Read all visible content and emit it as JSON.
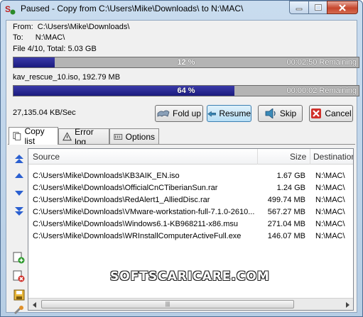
{
  "window": {
    "title": "Paused - Copy from C:\\Users\\Mike\\Downloads\\ to N:\\MAC\\"
  },
  "info": {
    "from_label": "From:",
    "from_value": "C:\\Users\\Mike\\Downloads\\",
    "to_label": "To:",
    "to_value": "N:\\MAC\\",
    "file_summary": "File 4/10, Total: 5.03 GB",
    "current_file": "kav_rescue_10.iso, 192.79 MB",
    "speed": "27,135.04 KB/Sec"
  },
  "progress": {
    "total": {
      "percent": 12,
      "label": "12 %",
      "remaining": "00:02:50 Remaining"
    },
    "file": {
      "percent": 64,
      "label": "64 %",
      "remaining": "00:00:02 Remaining"
    }
  },
  "buttons": {
    "fold_up": "Fold up",
    "resume": "Resume",
    "skip": "Skip",
    "cancel": "Cancel"
  },
  "tabs": {
    "copy_list": "Copy list",
    "error_log": "Error log",
    "options": "Options"
  },
  "list": {
    "columns": {
      "source": "Source",
      "size": "Size",
      "destination": "Destination"
    },
    "rows": [
      {
        "source": "C:\\Users\\Mike\\Downloads\\KB3AIK_EN.iso",
        "size": "1.67 GB",
        "destination": "N:\\MAC\\"
      },
      {
        "source": "C:\\Users\\Mike\\Downloads\\OfficialCnCTiberianSun.rar",
        "size": "1.24 GB",
        "destination": "N:\\MAC\\"
      },
      {
        "source": "C:\\Users\\Mike\\Downloads\\RedAlert1_AlliedDisc.rar",
        "size": "499.74 MB",
        "destination": "N:\\MAC\\"
      },
      {
        "source": "C:\\Users\\Mike\\Downloads\\VMware-workstation-full-7.1.0-2610...",
        "size": "567.27 MB",
        "destination": "N:\\MAC\\"
      },
      {
        "source": "C:\\Users\\Mike\\Downloads\\Windows6.1-KB968211-x86.msu",
        "size": "271.04 MB",
        "destination": "N:\\MAC\\"
      },
      {
        "source": "C:\\Users\\Mike\\Downloads\\WRInstallComputerActiveFull.exe",
        "size": "146.07 MB",
        "destination": "N:\\MAC\\"
      }
    ]
  },
  "watermark": "SOFTSCARICARE.COM",
  "colors": {
    "progress_fill": "#1f1f85",
    "progress_track": "#b4b4b4",
    "arrow_blue": "#2a5fd0"
  }
}
